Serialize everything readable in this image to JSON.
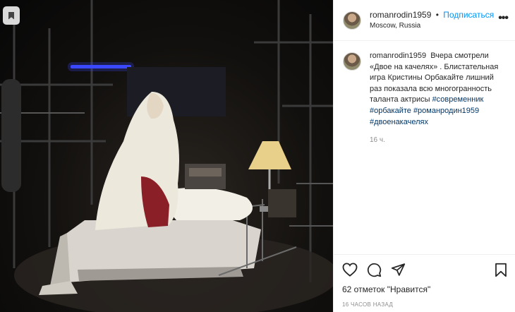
{
  "post": {
    "username": "romanrodin1959",
    "separator": "•",
    "follow_label": "Подписаться",
    "location": "Moscow, Russia",
    "more_label": "•••"
  },
  "caption": {
    "username": "romanrodin1959",
    "text": "Вчера смотрели «Двое на качелях» . Блистательная игра Кристины Орбакайте лишний раз показала всю многогранность таланта актрисы",
    "hashtags": [
      "#современник",
      "#орбакайте",
      "#романродин1959",
      "#двоенакачелях"
    ],
    "time": "16 ч."
  },
  "actions": {
    "icons": [
      "heart-icon",
      "comment-icon",
      "share-icon",
      "bookmark-icon"
    ],
    "likes_text": "62 отметок \"Нравится\"",
    "posted_ago": "16 ЧАСОВ НАЗАД"
  },
  "colors": {
    "link": "#0095f6",
    "hashtag": "#00376b",
    "muted": "#8e8e8e"
  }
}
